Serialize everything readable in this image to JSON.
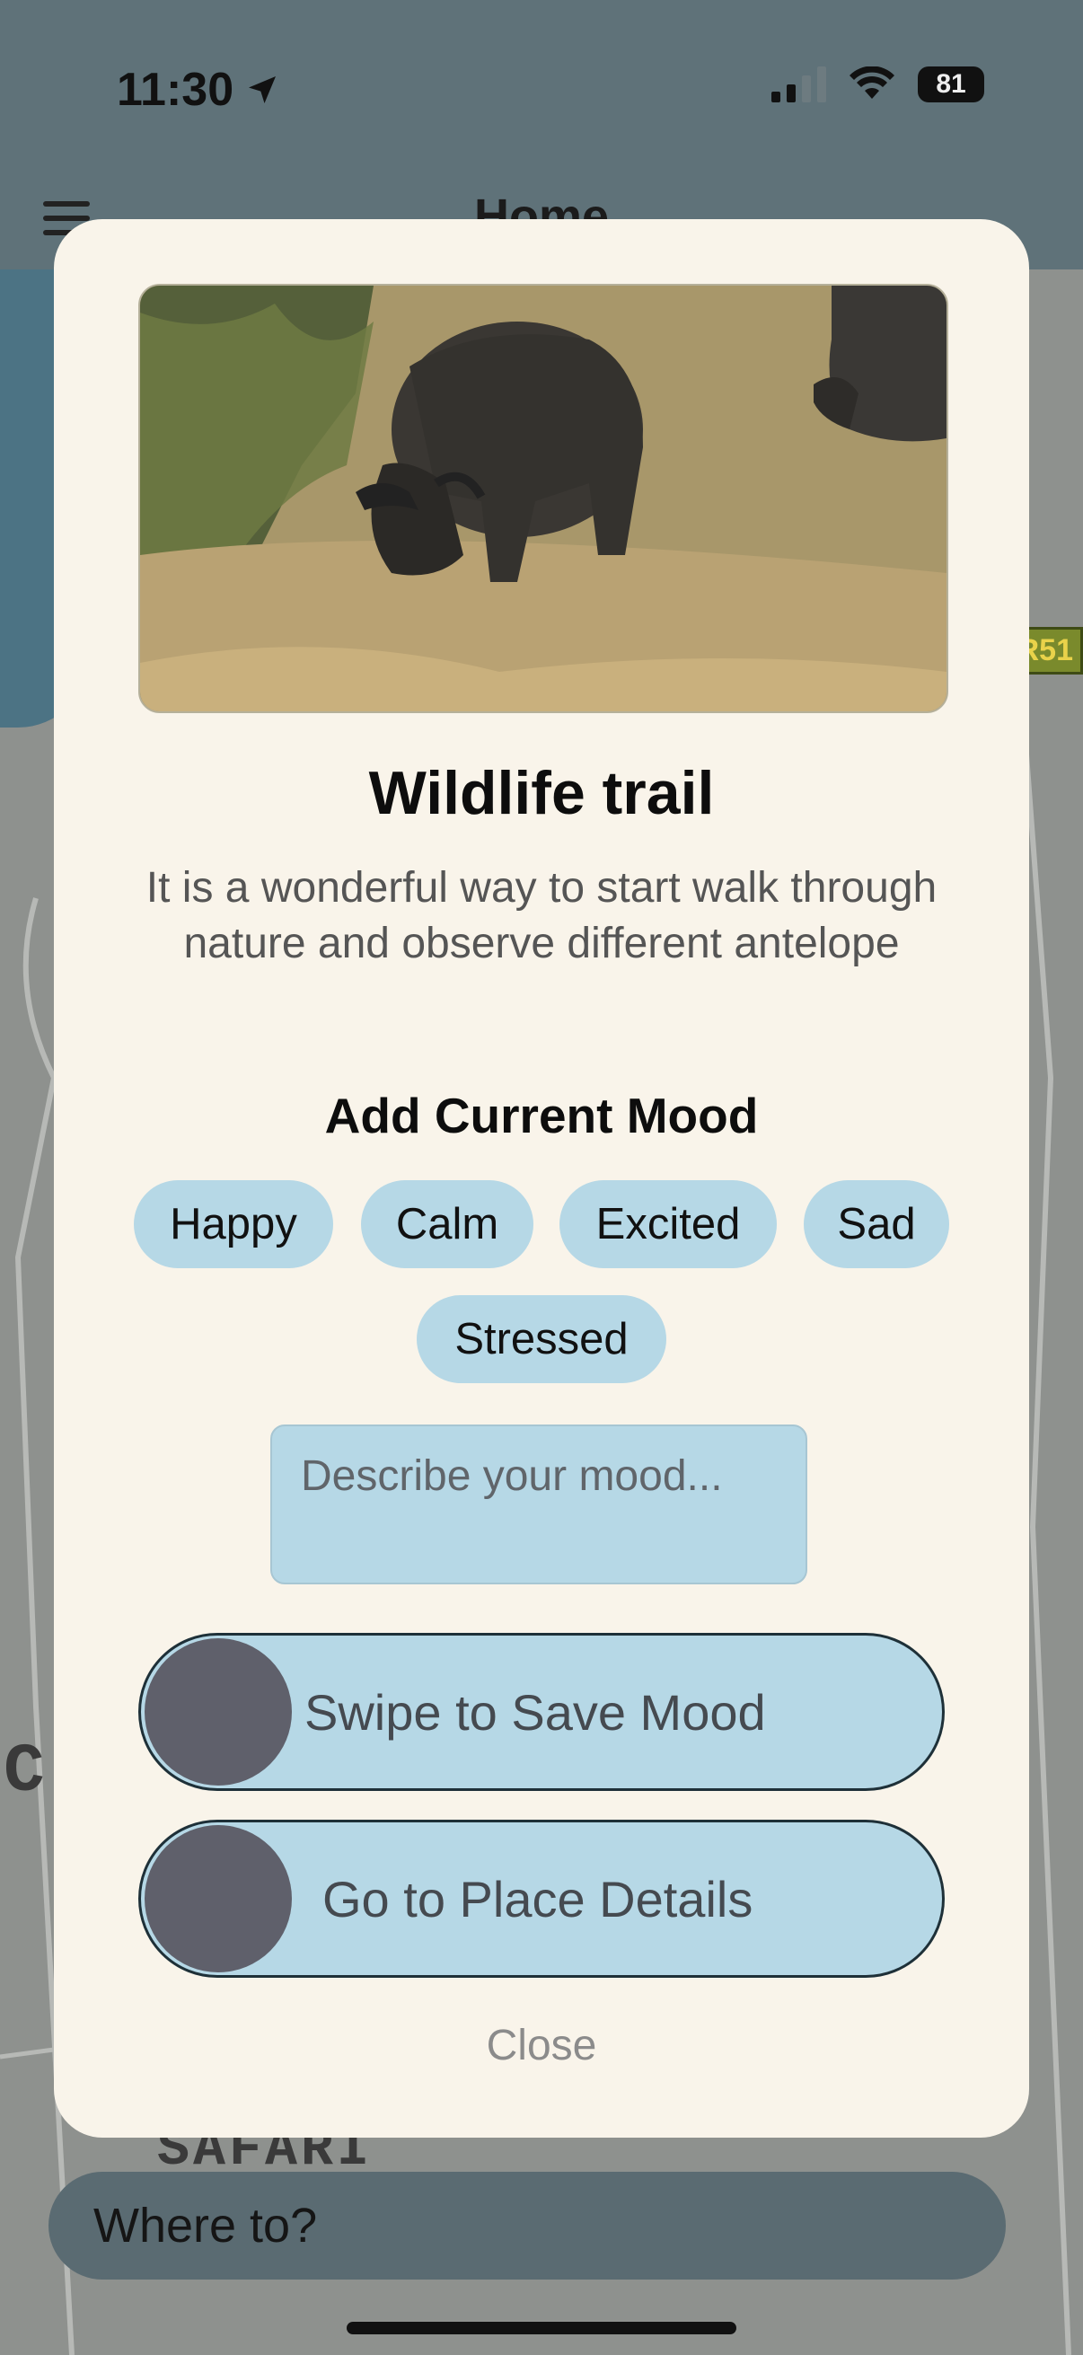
{
  "status_bar": {
    "time": "11:30",
    "battery": "81"
  },
  "background": {
    "header_title": "Home",
    "road_sign": "R51",
    "map_label_1": "C",
    "map_label_2": "SAFARI",
    "search_placeholder": "Where to?"
  },
  "modal": {
    "image_subject": "buffalo grazing in dry grass",
    "title": "Wildlife trail",
    "description": "It is a wonderful way to start walk through nature and observe different antelope",
    "mood_heading": "Add Current Mood",
    "moods": [
      "Happy",
      "Calm",
      "Excited",
      "Sad",
      "Stressed"
    ],
    "mood_placeholder": "Describe your mood...",
    "save_slider_label": "Swipe to Save Mood",
    "details_slider_label": "Go to Place Details",
    "close_label": "Close"
  },
  "colors": {
    "chip": "#b6d8e6",
    "modal_bg": "#f9f4ea",
    "knob": "#5f606b"
  }
}
